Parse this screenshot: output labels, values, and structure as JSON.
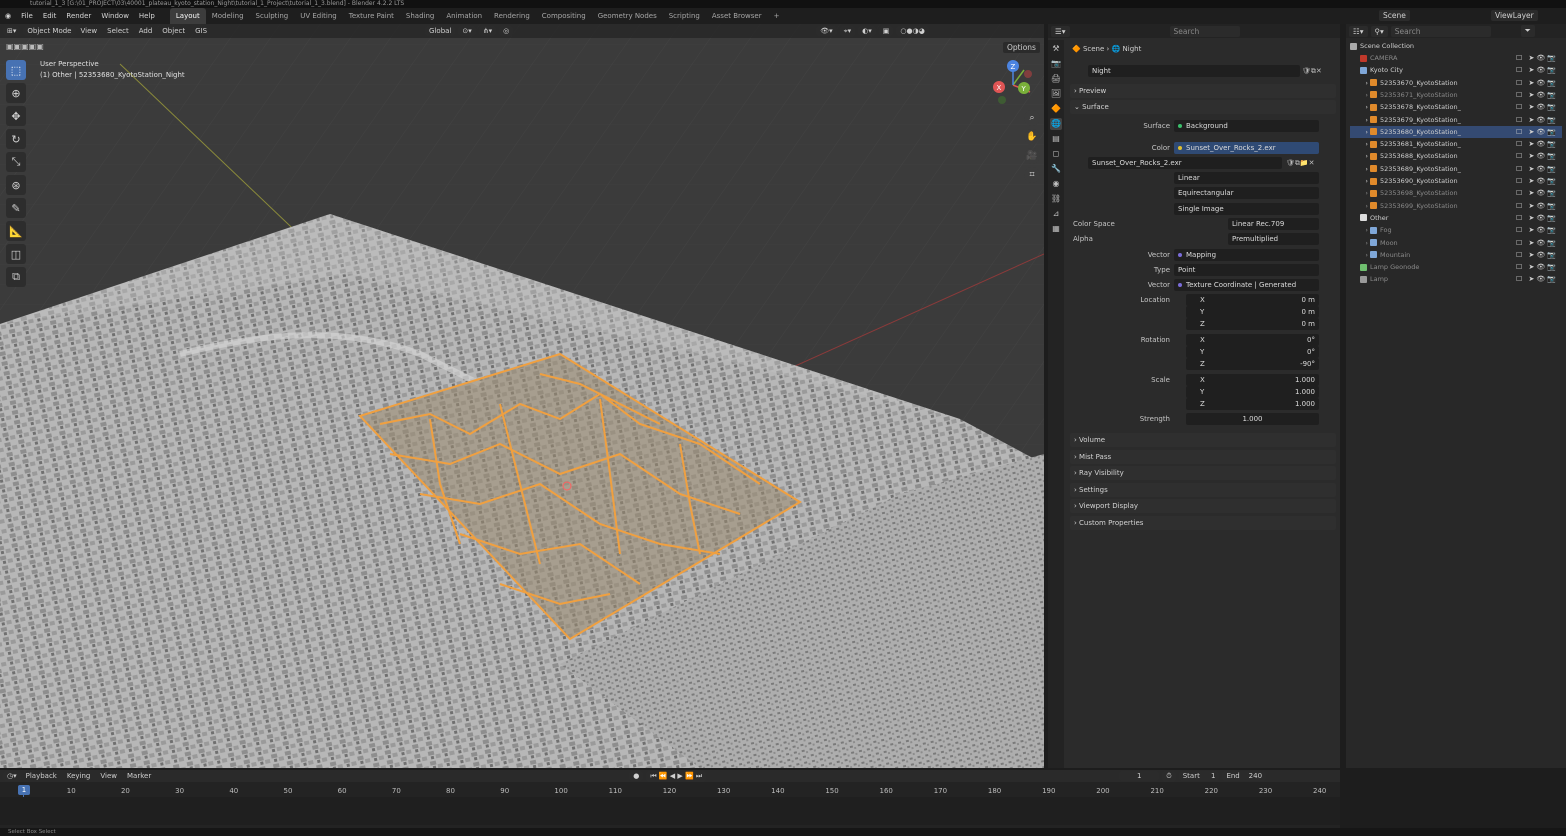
{
  "title": "tutorial_1_3 [G:\\01_PROJECT\\03\\40001_plateau_kyoto_station_Night\\tutorial_1_Project\\tutorial_1_3.blend] - Blender 4.2.2 LTS",
  "menu": [
    "File",
    "Edit",
    "Render",
    "Window",
    "Help"
  ],
  "workspaces": [
    "Layout",
    "Modeling",
    "Sculpting",
    "UV Editing",
    "Texture Paint",
    "Shading",
    "Animation",
    "Rendering",
    "Compositing",
    "Geometry Nodes",
    "Scripting",
    "Asset Browser"
  ],
  "viewport": {
    "mode": "Object Mode",
    "menus": [
      "View",
      "Select",
      "Add",
      "Object"
    ],
    "gis": "GIS",
    "transform": "Global",
    "options": "Options",
    "perspective": "User Perspective",
    "active_object": "(1) Other | 52353680_KyotoStation_Night",
    "axes": {
      "x": "X",
      "y": "Y",
      "z": "Z"
    }
  },
  "scene_header": {
    "scene": "Scene",
    "view_layer": "ViewLayer",
    "search": "Search"
  },
  "props": {
    "breadcrumb_scene": "Scene",
    "breadcrumb_world": "Night",
    "world_name": "Night",
    "preview": "Preview",
    "surface_panel": "Surface",
    "surface_label": "Surface",
    "surface_value": "Background",
    "color_label": "Color",
    "color_value": "Sunset_Over_Rocks_2.exr",
    "image_name": "Sunset_Over_Rocks_2.exr",
    "interp": "Linear",
    "projection": "Equirectangular",
    "source": "Single Image",
    "colorspace_label": "Color Space",
    "colorspace_value": "Linear Rec.709",
    "alpha_label": "Alpha",
    "alpha_value": "Premultiplied",
    "vector_label": "Vector",
    "vector_value": "Mapping",
    "type_label": "Type",
    "type_value": "Point",
    "vector2_label": "Vector",
    "vector2_value": "Texture Coordinate | Generated",
    "location_label": "Location",
    "rotation_label": "Rotation",
    "scale_label": "Scale",
    "strength_label": "Strength",
    "strength_value": "1.000",
    "loc": [
      {
        "axis": "X",
        "val": "0 m"
      },
      {
        "axis": "Y",
        "val": "0 m"
      },
      {
        "axis": "Z",
        "val": "0 m"
      }
    ],
    "rot": [
      {
        "axis": "X",
        "val": "0°"
      },
      {
        "axis": "Y",
        "val": "0°"
      },
      {
        "axis": "Z",
        "val": "-90°"
      }
    ],
    "scl": [
      {
        "axis": "X",
        "val": "1.000"
      },
      {
        "axis": "Y",
        "val": "1.000"
      },
      {
        "axis": "Z",
        "val": "1.000"
      }
    ],
    "panels": [
      "Volume",
      "Mist Pass",
      "Ray Visibility",
      "Settings",
      "Viewport Display",
      "Custom Properties"
    ]
  },
  "outliner": {
    "search": "Search",
    "root": "Scene Collection",
    "items": [
      {
        "name": "CAMERA",
        "dim": true,
        "sel": false,
        "indent": 1,
        "color": "#c0392b"
      },
      {
        "name": "Kyoto City",
        "dim": false,
        "sel": false,
        "indent": 1,
        "color": "#7fa7d8"
      },
      {
        "name": "52353670_KyotoStation",
        "dim": false,
        "sel": false,
        "indent": 2,
        "color": "#e08a2b"
      },
      {
        "name": "52353671_KyotoStation",
        "dim": true,
        "sel": false,
        "indent": 2,
        "color": "#e08a2b"
      },
      {
        "name": "52353678_KyotoStation_",
        "dim": false,
        "sel": false,
        "indent": 2,
        "color": "#e08a2b"
      },
      {
        "name": "52353679_KyotoStation_",
        "dim": false,
        "sel": false,
        "indent": 2,
        "color": "#e08a2b"
      },
      {
        "name": "52353680_KyotoStation_",
        "dim": false,
        "sel": true,
        "indent": 2,
        "color": "#e08a2b"
      },
      {
        "name": "52353681_KyotoStation_",
        "dim": false,
        "sel": false,
        "indent": 2,
        "color": "#e08a2b"
      },
      {
        "name": "52353688_KyotoStation",
        "dim": false,
        "sel": false,
        "indent": 2,
        "color": "#e08a2b"
      },
      {
        "name": "52353689_KyotoStation_",
        "dim": false,
        "sel": false,
        "indent": 2,
        "color": "#e08a2b"
      },
      {
        "name": "52353690_KyotoStation",
        "dim": false,
        "sel": false,
        "indent": 2,
        "color": "#e08a2b"
      },
      {
        "name": "52353698_KyotoStation",
        "dim": true,
        "sel": false,
        "indent": 2,
        "color": "#e08a2b"
      },
      {
        "name": "52353699_KyotoStation",
        "dim": true,
        "sel": false,
        "indent": 2,
        "color": "#e08a2b"
      },
      {
        "name": "Other",
        "dim": false,
        "sel": false,
        "indent": 1,
        "color": "#dddddd"
      },
      {
        "name": "Fog",
        "dim": true,
        "sel": false,
        "indent": 2,
        "color": "#7fa7d8"
      },
      {
        "name": "Moon",
        "dim": true,
        "sel": false,
        "indent": 2,
        "color": "#7fa7d8"
      },
      {
        "name": "Mountain",
        "dim": true,
        "sel": false,
        "indent": 2,
        "color": "#7fa7d8"
      },
      {
        "name": "Lamp Geonode",
        "dim": true,
        "sel": false,
        "indent": 1,
        "color": "#6fbf6f"
      },
      {
        "name": "Lamp",
        "dim": true,
        "sel": false,
        "indent": 1,
        "color": "#9a9a9a"
      }
    ]
  },
  "timeline": {
    "menus": [
      "Playback",
      "Keying",
      "View",
      "Marker"
    ],
    "current": "1",
    "start_label": "Start",
    "start": "1",
    "end_label": "End",
    "end": "240",
    "frame_badge": "1",
    "ticks": [
      "10",
      "20",
      "30",
      "40",
      "50",
      "60",
      "70",
      "80",
      "90",
      "100",
      "110",
      "120",
      "130",
      "140",
      "150",
      "160",
      "170",
      "180",
      "190",
      "200",
      "210",
      "220",
      "230",
      "240"
    ]
  },
  "status": "Select      Box Select"
}
